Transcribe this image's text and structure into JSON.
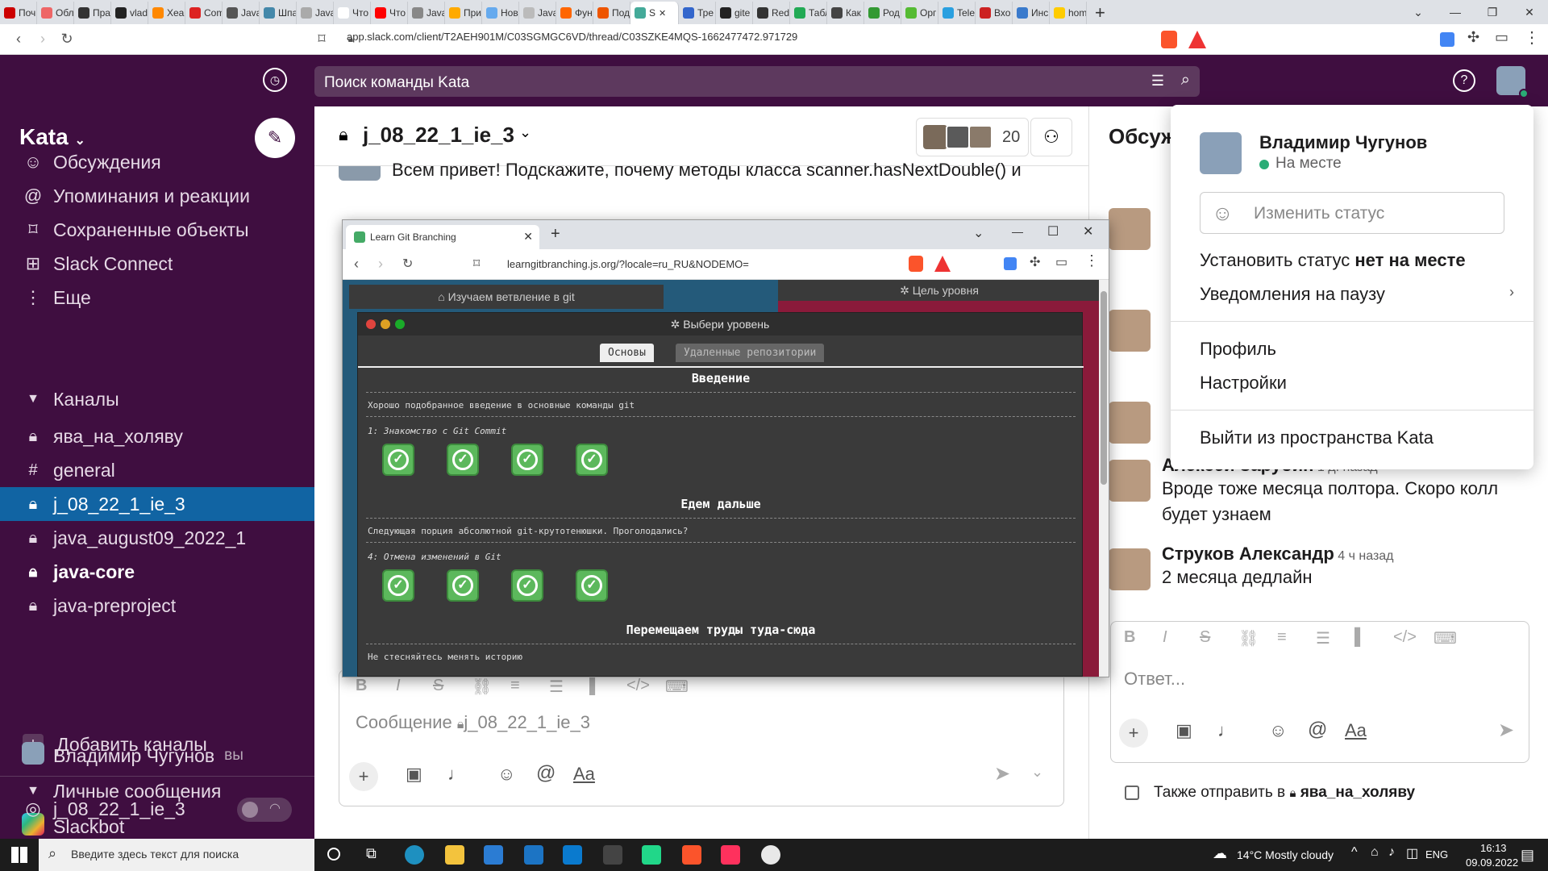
{
  "browser": {
    "tabs": [
      "Поч",
      "Обл",
      "Пра",
      "vlad",
      "Хеа",
      "Com",
      "Java",
      "Шпа",
      "Java",
      "Что",
      "Что",
      "Java",
      "При",
      "Нов",
      "Java",
      "Фун",
      "Под",
      "S",
      "Тре",
      "gite",
      "Red",
      "Табл",
      "Как",
      "Род",
      "Орг",
      "Tele",
      "Вхо",
      "Инс",
      "hom"
    ],
    "url": "app.slack.com/client/T2AEH901M/C03SGMGC6VD/thread/C03SZKE4MQS-1662477472.971729"
  },
  "slack": {
    "search_placeholder": "Поиск команды Kata",
    "workspace": "Kata",
    "nav": [
      "Обсуждения",
      "Упоминания и реакции",
      "Сохраненные объекты",
      "Slack Connect",
      "Еще"
    ],
    "channels_header": "Каналы",
    "channels": [
      "ява_на_холяву",
      "general",
      "j_08_22_1_ie_3",
      "java_august09_2022_1",
      "java-core",
      "java-preproject"
    ],
    "add_channels": "Добавить каналы",
    "dm_header": "Личные сообщения",
    "dms": [
      "Slackbot",
      "Владимир Чугунов"
    ],
    "dm_you": "вы",
    "huddle_channel": "j_08_22_1_ie_3",
    "channel_title": "j_08_22_1_ie_3",
    "member_count": "20",
    "partial_msg": "Всем привет! Подскажите, почему методы класса scanner.hasNextDouble() и",
    "composer_placeholder": "Сообщение",
    "composer_channel": "j_08_22_1_ie_3",
    "thread_title": "Обсуж",
    "thread_messages": [
      {
        "name": "Алексей Зарубин",
        "time": "1 д. назад",
        "text": "Вроде тоже месяца полтора. Скоро колл будет узнаем"
      },
      {
        "name": "Струков Александр",
        "time": "4 ч назад",
        "text": "2 месяца дедлайн"
      }
    ],
    "reply_placeholder": "Ответ...",
    "also_send": "Также отправить в",
    "also_send_channel": "ява_на_холяву"
  },
  "profile_menu": {
    "name": "Владимир Чугунов",
    "status": "На месте",
    "change_status": "Изменить статус",
    "set_away_prefix": "Установить статус",
    "set_away_bold": "нет на месте",
    "pause": "Уведомления на паузу",
    "profile": "Профиль",
    "settings": "Настройки",
    "signout": "Выйти из пространства Kata"
  },
  "gitwin": {
    "tab_title": "Learn Git Branching",
    "url": "learngitbranching.js.org/?locale=ru_RU&NODEMO=",
    "bg_win1": "Изучаем ветвление в git",
    "bg_win2": "Цель уровня",
    "dialog_title": "Выбери уровень",
    "tabs": [
      "Основы",
      "Удаленные репозитории"
    ],
    "sections": [
      {
        "title": "Введение",
        "desc": "Хорошо подобранное введение в основные команды git",
        "sub": "1: Знакомство с Git Commit"
      },
      {
        "title": "Едем дальше",
        "desc": "Следующая порция абсолютной git-крутотенюшки. Проголодались?",
        "sub": "4: Отмена изменений в Git"
      },
      {
        "title": "Перемещаем труды туда-сюда",
        "desc": "Не стесняйтесь менять историю",
        "sub": ""
      }
    ]
  },
  "taskbar": {
    "search": "Введите здесь текст для поиска",
    "weather": "14°C  Mostly cloudy",
    "lang": "ENG",
    "time": "16:13",
    "date": "09.09.2022"
  }
}
